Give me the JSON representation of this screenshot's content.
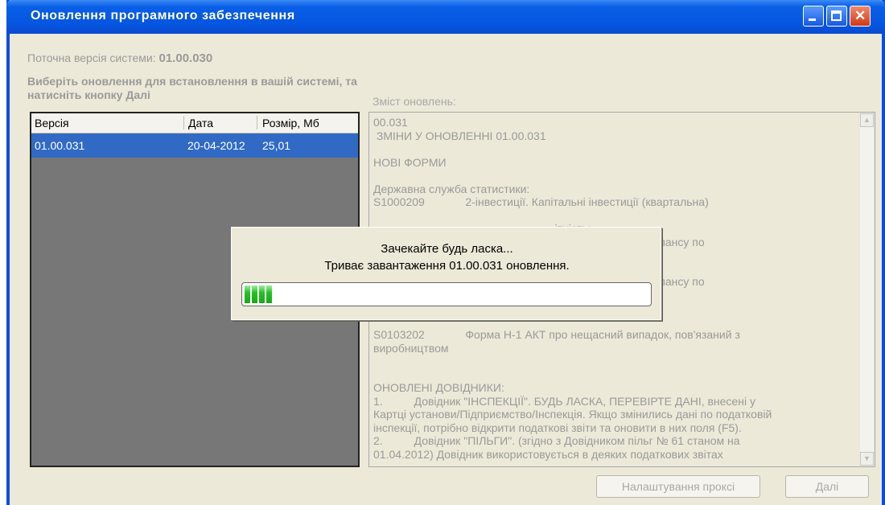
{
  "window": {
    "title": "Оновлення програмного забезпечення",
    "controls": {
      "minimize": "minimize-icon",
      "maximize": "maximize-icon",
      "close": "close-icon"
    }
  },
  "current_version": {
    "label": "Поточна версія системи:",
    "value": "01.00.030"
  },
  "instruction": "Виберіть оновлення для встановлення в вашій системі, та натисніть кнопку Далі",
  "updates_table": {
    "columns": [
      "Версія",
      "Дата",
      "Розмір, Мб"
    ],
    "rows": [
      {
        "version": "01.00.031",
        "date": "20-04-2012",
        "size": "25,01"
      }
    ]
  },
  "content": {
    "label": "Зміст оновлень:",
    "text": "00.031\n ЗМІНИ У ОНОВЛЕННІ 01.00.031\n\nНОВІ ФОРМИ\n\nДержавна служба статистики:\nS1000209             2-інвестиції. Капітальні інвестиції (квартальна)\n\n                                                          ітність:\n                                                          шків на рахунках балансу по\n\n\n                                                          шків на рахунках балансу по\n\n\n\nS0103202             Форма Н-1 АКТ про нещасний випадок, пов'язаний з\nвиробництвом\n\n\nОНОВЛЕНІ ДОВІДНИКИ:\n1.          Довідник \"ІНСПЕКЦІЇ\". БУДЬ ЛАСКА, ПЕРЕВІРТЕ ДАНІ, внесені у\nКартці установи/Підприємство/Інспекція. Якщо змінились дані по податковій\nінспекції, потрібно відкрити податкові звіти та оновити в них поля (F5).\n2.          Довідник \"ПІЛЬГИ\". (згідно з Довідником пільг № 61 станом на\n01.04.2012) Довідник використовується в деяких податкових звітах"
  },
  "buttons": {
    "proxy": "Налаштування проксі",
    "next": "Далі"
  },
  "progress_dialog": {
    "line1": "Зачекайте будь ласка...",
    "line2": "Триває завантаження 01.00.031 оновлення.",
    "progress_fraction": 0.07
  },
  "colors": {
    "title_bar": "#0556e0",
    "selection": "#316ac5",
    "progress": "#28c028"
  }
}
